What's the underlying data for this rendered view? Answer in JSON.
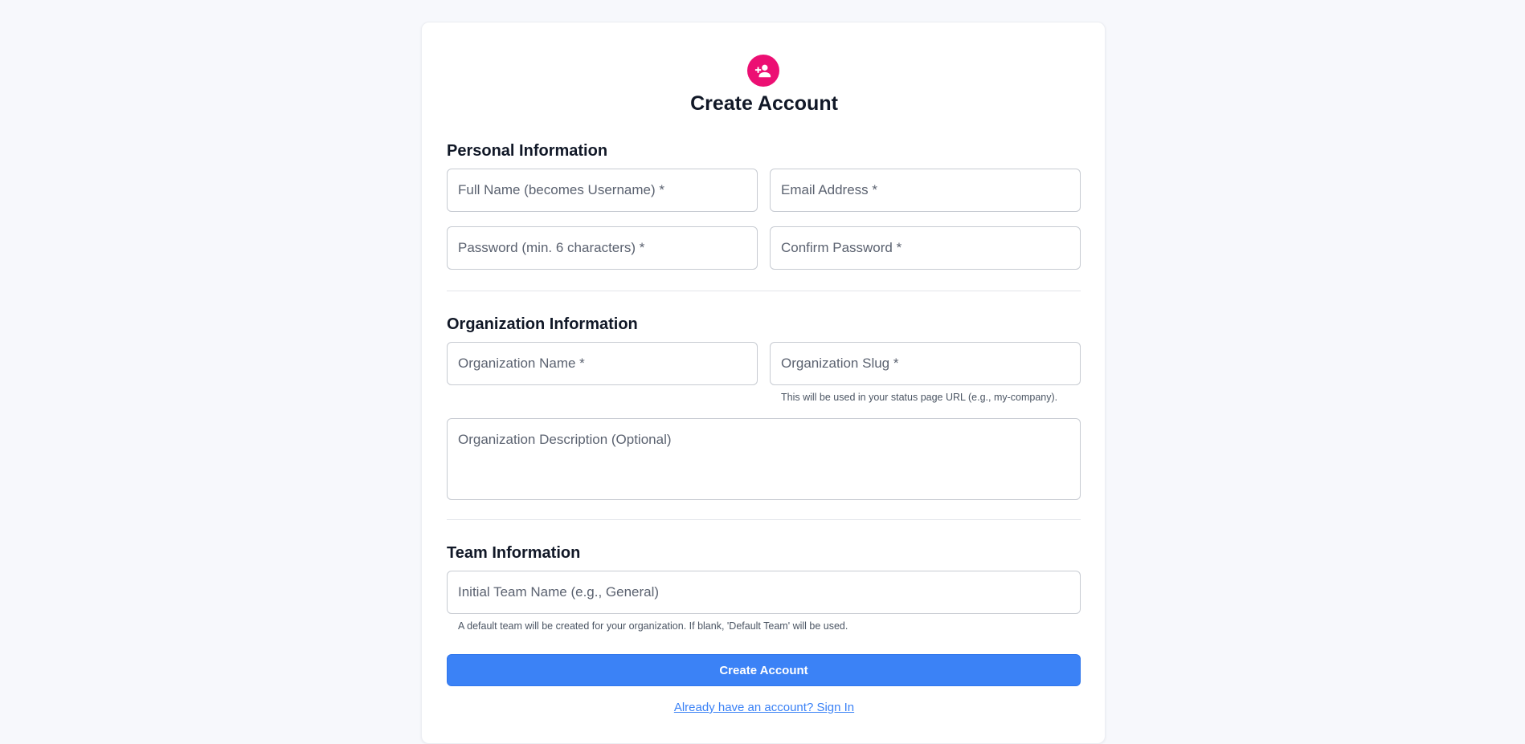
{
  "header": {
    "icon": "user-plus-icon",
    "title": "Create Account",
    "accent_color": "#ec0f73"
  },
  "personal": {
    "heading": "Personal Information",
    "full_name_placeholder": "Full Name (becomes Username) *",
    "email_placeholder": "Email Address *",
    "password_placeholder": "Password (min. 6 characters) *",
    "confirm_password_placeholder": "Confirm Password *"
  },
  "organization": {
    "heading": "Organization Information",
    "name_placeholder": "Organization Name *",
    "slug_placeholder": "Organization Slug *",
    "slug_helper": "This will be used in your status page URL (e.g., my-company).",
    "description_placeholder": "Organization Description (Optional)"
  },
  "team": {
    "heading": "Team Information",
    "name_placeholder": "Initial Team Name (e.g., General)",
    "name_helper": "A default team will be created for your organization. If blank, 'Default Team' will be used."
  },
  "actions": {
    "submit_label": "Create Account",
    "submit_color": "#3b82f6",
    "signin_link": "Already have an account? Sign In"
  }
}
